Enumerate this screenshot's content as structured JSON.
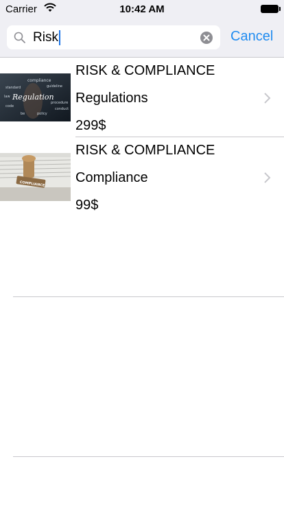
{
  "status_bar": {
    "carrier": "Carrier",
    "time": "10:42 AM"
  },
  "search": {
    "query": "Risk",
    "cancel_label": "Cancel"
  },
  "results": [
    {
      "category": "RISK & COMPLIANCE",
      "title": "Regulations",
      "price": "299$",
      "image_text": [
        "compliance",
        "guideline",
        "standard",
        "Regulation",
        "law",
        "procedure",
        "code",
        "conduct",
        "be",
        "policy"
      ]
    },
    {
      "category": "RISK & COMPLIANCE",
      "title": "Compliance",
      "price": "99$",
      "image_text": [
        "COMPLIANCE"
      ]
    }
  ],
  "colors": {
    "accent": "#1f8bf0",
    "search_bar_bg": "#efeff4",
    "separator": "#c8c7cc",
    "chevron": "#c7c7cc"
  }
}
